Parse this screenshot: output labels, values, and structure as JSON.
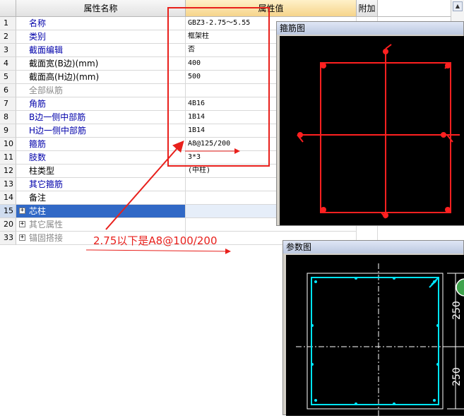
{
  "grid": {
    "headers": {
      "name": "属性名称",
      "value": "属性值",
      "extra": "附加"
    },
    "rows": [
      {
        "num": "1",
        "name": "名称",
        "value": "GBZ3-2.75～5.55",
        "color": "blue"
      },
      {
        "num": "2",
        "name": "类别",
        "value": "框架柱",
        "color": "blue"
      },
      {
        "num": "3",
        "name": "截面编辑",
        "value": "否",
        "color": "blue"
      },
      {
        "num": "4",
        "name": "截面宽(B边)(mm)",
        "value": "400",
        "color": "black"
      },
      {
        "num": "5",
        "name": "截面高(H边)(mm)",
        "value": "500",
        "color": "black"
      },
      {
        "num": "6",
        "name": "全部纵筋",
        "value": "",
        "color": "grey"
      },
      {
        "num": "7",
        "name": "角筋",
        "value": "4B16",
        "color": "blue"
      },
      {
        "num": "8",
        "name": "B边一侧中部筋",
        "value": "1B14",
        "color": "blue"
      },
      {
        "num": "9",
        "name": "H边一侧中部筋",
        "value": "1B14",
        "color": "blue"
      },
      {
        "num": "10",
        "name": "箍筋",
        "value": "A8@125/200",
        "color": "blue"
      },
      {
        "num": "11",
        "name": "肢数",
        "value": "3*3",
        "color": "blue"
      },
      {
        "num": "12",
        "name": "柱类型",
        "value": "(中柱)",
        "color": "black"
      },
      {
        "num": "13",
        "name": "其它箍筋",
        "value": "",
        "color": "blue"
      },
      {
        "num": "14",
        "name": "备注",
        "value": "",
        "color": "black"
      },
      {
        "num": "15",
        "name": "芯柱",
        "value": "",
        "color": "white",
        "expander": "+",
        "selected": true
      },
      {
        "num": "20",
        "name": "其它属性",
        "value": "",
        "color": "grey",
        "expander": "+"
      },
      {
        "num": "33",
        "name": "锚固搭接",
        "value": "",
        "color": "grey",
        "expander": "+"
      }
    ]
  },
  "stirrup_panel": {
    "title": "箍筋图"
  },
  "param_panel": {
    "title": "参数图",
    "dimensions": [
      "250",
      "250"
    ]
  },
  "annotation": {
    "text": "2.75以下是A8@100/200",
    "color": "#e8201c"
  },
  "colors": {
    "rebar": "#ff2020",
    "param_lines": "#00e5ff",
    "selection": "#3169c6",
    "annotation": "#e8201c"
  }
}
